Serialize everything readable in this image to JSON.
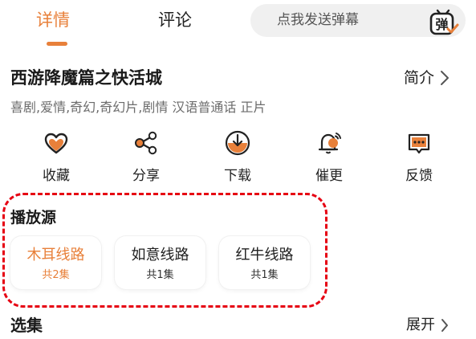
{
  "tabs": {
    "detail": "详情",
    "comment": "评论"
  },
  "danmaku": {
    "placeholder": "点我发送弹幕",
    "icon_text": "弹",
    "icon": "danmaku-icon"
  },
  "movie": {
    "title": "西游降魔篇之快活城",
    "intro_label": "简介",
    "tags": "喜剧,爱情,奇幻,奇幻片,剧情 汉语普通话 正片"
  },
  "actions": [
    {
      "label": "收藏",
      "icon": "heart-icon"
    },
    {
      "label": "分享",
      "icon": "share-icon"
    },
    {
      "label": "下载",
      "icon": "download-icon"
    },
    {
      "label": "催更",
      "icon": "bell-icon"
    },
    {
      "label": "反馈",
      "icon": "feedback-icon"
    }
  ],
  "source": {
    "heading": "播放源",
    "routes": [
      {
        "name": "木耳线路",
        "count": "共2集",
        "active": true
      },
      {
        "name": "如意线路",
        "count": "共1集",
        "active": false
      },
      {
        "name": "红牛线路",
        "count": "共1集",
        "active": false
      }
    ]
  },
  "episodes": {
    "heading": "选集",
    "expand_label": "展开"
  },
  "colors": {
    "accent": "#e8803a",
    "highlight_border": "#e60012",
    "text": "#1f1f1f",
    "muted": "#6b6b6b"
  }
}
